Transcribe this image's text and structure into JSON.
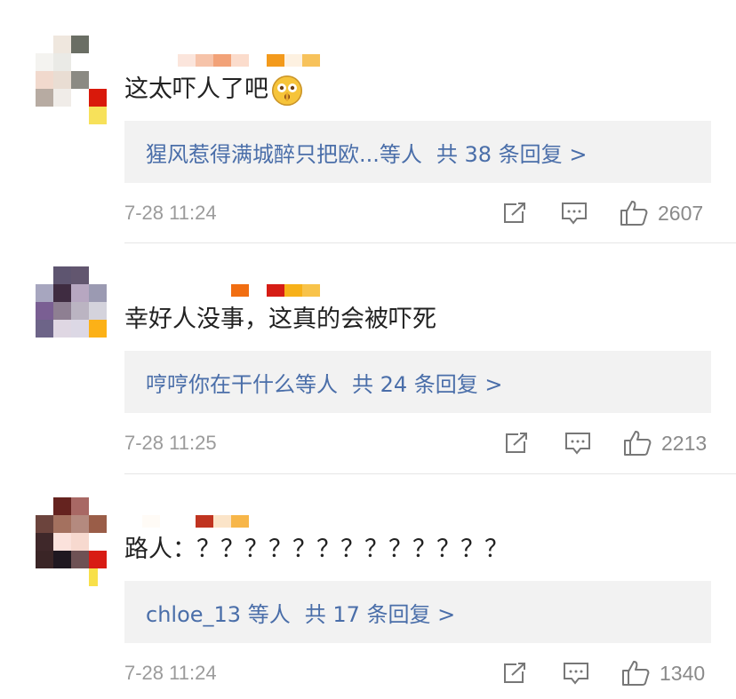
{
  "comments": [
    {
      "text": "这太吓人了吧",
      "reply_preview": "猩风惹得满城醉只把欧...等人",
      "reply_total": "共 38 条回复 >",
      "time": "7-28 11:24",
      "likes": "2607",
      "emoji": "shocked-shushing-face-icon"
    },
    {
      "text": "幸好人没事，这真的会被吓死",
      "reply_preview": "哼哼你在干什么等人",
      "reply_total": "共 24 条回复 >",
      "time": "7-28 11:25",
      "likes": "2213"
    },
    {
      "text": "路人：？？？？？？？？？？？？？",
      "reply_preview": "chloe_13 等人",
      "reply_total": "共 17 条回复 >",
      "time": "7-28 11:24",
      "likes": "1340"
    }
  ],
  "icons": {
    "repost": "share-icon",
    "comment": "comment-icon",
    "like": "thumbs-up-icon"
  },
  "colors": {
    "link": "#4a6ea9",
    "reply_bg": "#f2f2f2",
    "meta": "#9b9b9b"
  }
}
